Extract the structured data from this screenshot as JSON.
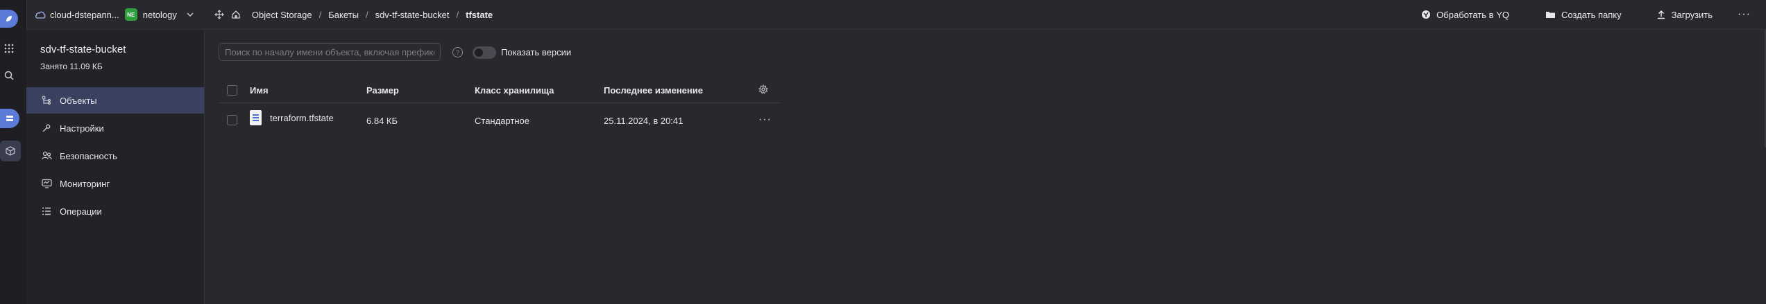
{
  "topbar": {
    "cloud_name": "cloud-dstepann...",
    "org_badge": "NE",
    "org_name": "netology",
    "breadcrumbs": [
      "Object Storage",
      "Бакеты",
      "sdv-tf-state-bucket",
      "tfstate"
    ],
    "actions": {
      "yq": "Обработать в YQ",
      "create_folder": "Создать папку",
      "upload": "Загрузить"
    }
  },
  "rail": {
    "icons": [
      "app-logo-icon",
      "grid-menu-icon",
      "search-icon",
      "storage-service-icon",
      "bucket-service-icon"
    ]
  },
  "sidebar": {
    "bucket_name": "sdv-tf-state-bucket",
    "used": "Занято 11.09 КБ",
    "items": [
      {
        "label": "Объекты",
        "icon": "objects-icon",
        "active": true
      },
      {
        "label": "Настройки",
        "icon": "wrench-icon",
        "active": false
      },
      {
        "label": "Безопасность",
        "icon": "users-icon",
        "active": false
      },
      {
        "label": "Мониторинг",
        "icon": "monitor-icon",
        "active": false
      },
      {
        "label": "Операции",
        "icon": "list-icon",
        "active": false
      }
    ]
  },
  "main": {
    "search_placeholder": "Поиск по началу имени объекта, включая префикс",
    "show_versions_label": "Показать версии",
    "show_versions_on": false,
    "columns": [
      "Имя",
      "Размер",
      "Класс хранилища",
      "Последнее изменение"
    ],
    "rows": [
      {
        "name": "terraform.tfstate",
        "size": "6.84 КБ",
        "storage_class": "Стандартное",
        "modified": "25.11.2024, в 20:41"
      }
    ]
  },
  "colors": {
    "background": "#28282d",
    "accent": "#5c7bd9",
    "active_nav": "#394060",
    "badge": "#2e9e3e"
  }
}
